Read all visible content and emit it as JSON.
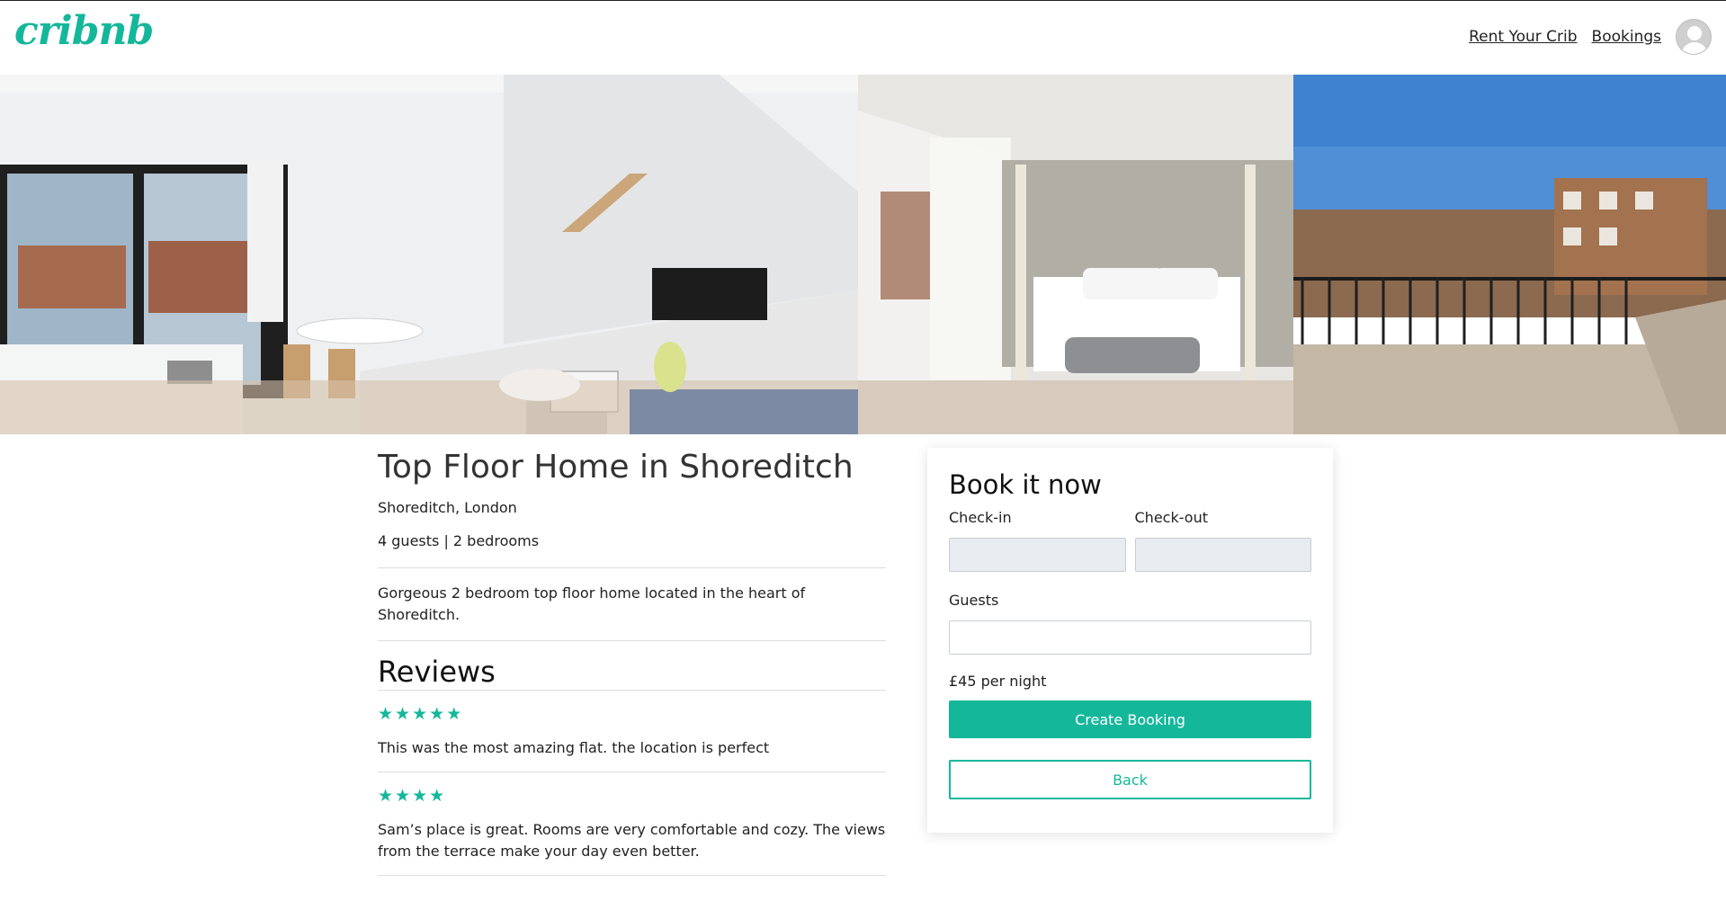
{
  "brand": {
    "logo_text": "cribnb",
    "accent": "#15b79b"
  },
  "nav": {
    "rent_label": "Rent Your Crib",
    "bookings_label": "Bookings",
    "avatar_icon": "user-avatar-icon"
  },
  "gallery": {
    "photos": [
      {
        "icon": "living-room-photo"
      },
      {
        "icon": "bedroom-photo"
      },
      {
        "icon": "terrace-photo"
      }
    ]
  },
  "listing": {
    "title": "Top Floor Home in Shoreditch",
    "location": "Shoreditch, London",
    "meta": "4 guests | 2 bedrooms",
    "description": "Gorgeous 2 bedroom top floor home located in the heart of Shoreditch."
  },
  "reviews": {
    "heading": "Reviews",
    "items": [
      {
        "rating": 5,
        "text": "This was the most amazing flat. the location is perfect"
      },
      {
        "rating": 4,
        "text": "Sam’s place is great. Rooms are very comfortable and cozy. The views from the terrace make your day even better."
      }
    ]
  },
  "booking": {
    "heading": "Book it now",
    "checkin_label": "Check-in",
    "checkin_value": "",
    "checkout_label": "Check-out",
    "checkout_value": "",
    "guests_label": "Guests",
    "guests_value": "",
    "price": "£45 per night",
    "create_label": "Create Booking",
    "back_label": "Back"
  }
}
